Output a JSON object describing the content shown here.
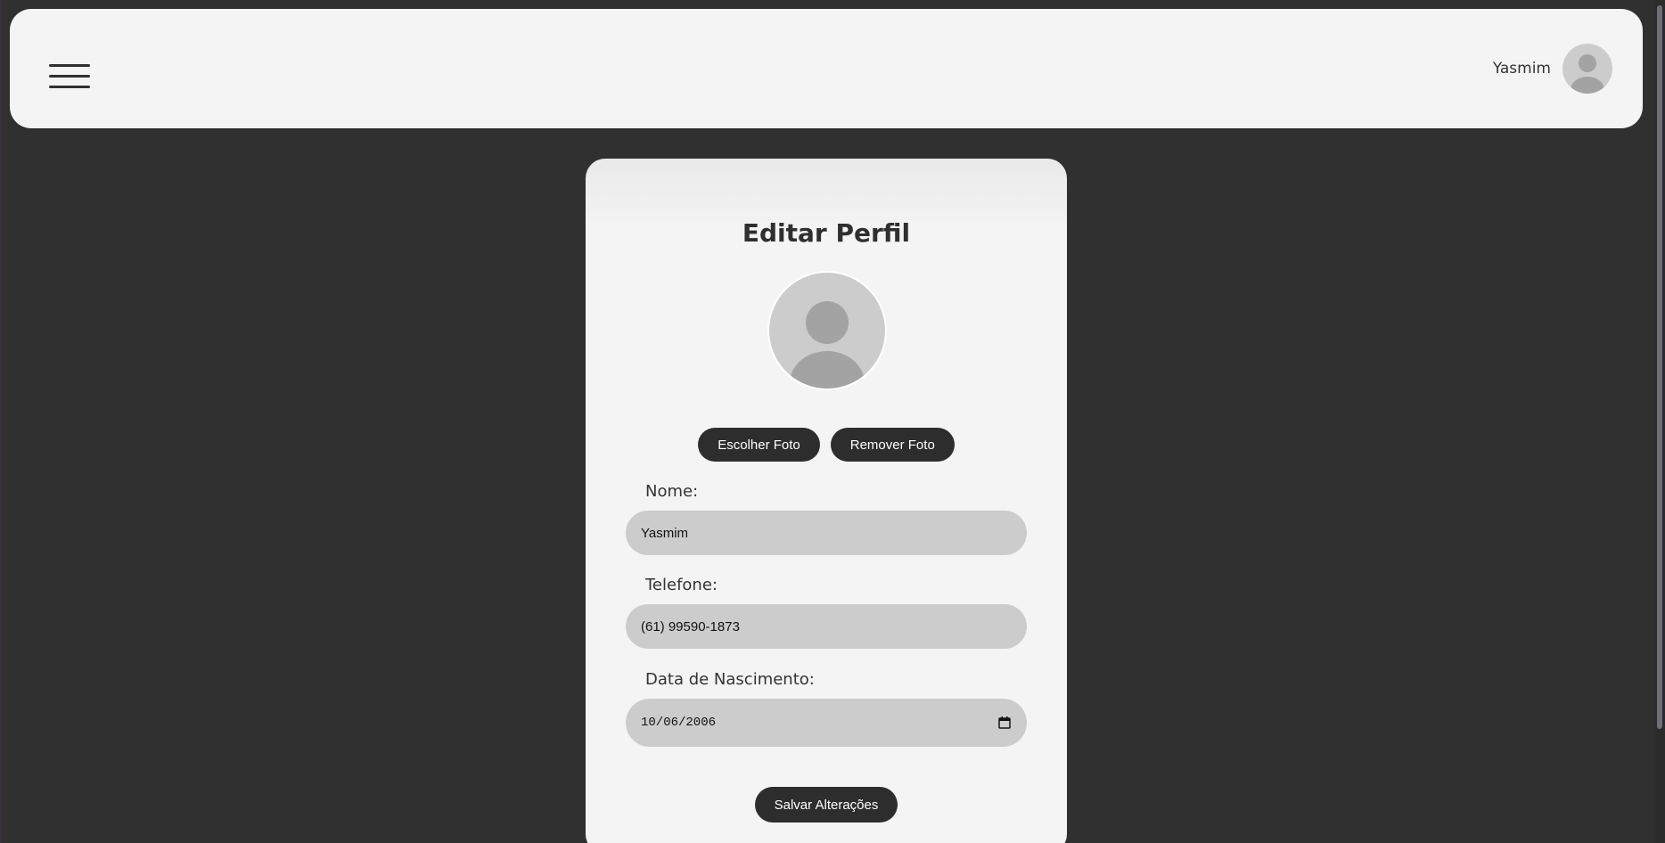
{
  "header": {
    "user_name": "Yasmim",
    "menu_icon": "hamburger-menu-icon",
    "avatar_icon": "user-avatar-icon"
  },
  "card": {
    "title": "Editar Perfil",
    "avatar_icon": "user-avatar-icon",
    "choose_photo_label": "Escolher Foto",
    "remove_photo_label": "Remover Foto"
  },
  "form": {
    "name_label": "Nome:",
    "name_value": "Yasmim",
    "phone_label": "Telefone:",
    "phone_value": "(61) 99590-1873",
    "birth_label": "Data de Nascimento:",
    "birth_value": "10/06/2006",
    "calendar_icon": "calendar-icon",
    "save_label": "Salvar Alterações"
  },
  "colors": {
    "background": "#303030",
    "surface": "#f4f4f4",
    "input": "#cccccc",
    "button": "#2d2d2d",
    "button_text": "#ffffff"
  }
}
